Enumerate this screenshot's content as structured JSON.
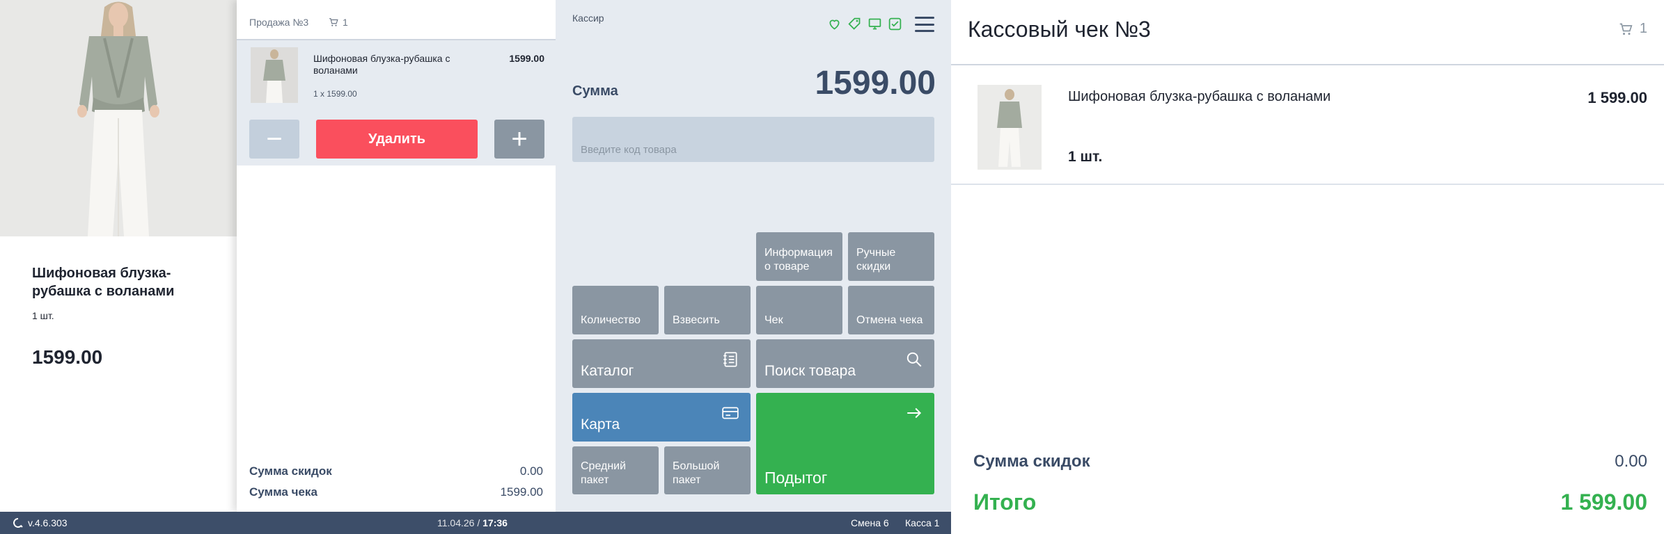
{
  "product": {
    "name": "Шифоновая блузка-рубашка с воланами",
    "qty": "1 шт.",
    "price": "1599.00"
  },
  "sale": {
    "title": "Продажа №3",
    "cart_count": "1",
    "item": {
      "name": "Шифоновая блузка-рубашка с воланами",
      "price": "1599.00",
      "qty_line": "1 x 1599.00"
    },
    "minus_label": "−",
    "delete_label": "Удалить",
    "plus_label": "+",
    "discount_label": "Сумма скидок",
    "discount_value": "0.00",
    "total_label": "Сумма чека",
    "total_value": "1599.00"
  },
  "cashier": {
    "label": "Кассир",
    "status_icons": [
      "heart-icon",
      "tag-icon",
      "monitor-icon",
      "check-box-icon"
    ],
    "sum_label": "Сумма",
    "sum_value": "1599.00",
    "code_placeholder": "Введите код товара",
    "keys": {
      "product_info": "Информация\nо товаре",
      "manual_discounts": "Ручные\nскидки",
      "quantity": "Количество",
      "weigh": "Взвесить",
      "receipt": "Чек",
      "cancel_receipt": "Отмена чека",
      "catalog": "Каталог",
      "product_search": "Поиск товара",
      "card": "Карта",
      "medium_bag": "Средний\nпакет",
      "large_bag": "Большой\nпакет",
      "subtotal": "Подытог"
    }
  },
  "receipt": {
    "title": "Кассовый чек №3",
    "cart_count": "1",
    "item": {
      "name": "Шифоновая блузка-рубашка с воланами",
      "price": "1 599.00",
      "qty": "1 шт."
    },
    "discount_label": "Сумма скидок",
    "discount_value": "0.00",
    "total_label": "Итого",
    "total_value": "1 599.00"
  },
  "footer": {
    "version": "v.4.6.303",
    "date": "11.04.26 /",
    "time": "17:36",
    "shift": "Смена 6",
    "register": "Касса 1"
  },
  "colors": {
    "accent_red": "#fa4f5d",
    "accent_green": "#34b150",
    "accent_blue": "#4b85b8",
    "key_gray": "#8a96a2",
    "footer_bg": "#3d4e69",
    "panel_bg": "#e6ebf1"
  }
}
